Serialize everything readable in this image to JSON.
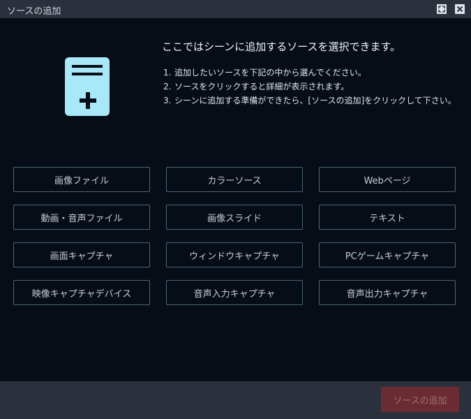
{
  "window": {
    "title": "ソースの追加",
    "maximize_icon": "maximize-icon",
    "close_icon": "close-icon"
  },
  "intro": {
    "heading": "ここではシーンに追加するソースを選択できます。",
    "steps": [
      {
        "num": "1.",
        "text": "追加したいソースを下記の中から選んでください。"
      },
      {
        "num": "2.",
        "text": "ソースをクリックすると詳細が表示されます。"
      },
      {
        "num": "3.",
        "text": "シーンに追加する準備ができたら、[ソースの追加]をクリックして下さい。"
      }
    ],
    "icon": "document-add-icon"
  },
  "sources": [
    "画像ファイル",
    "カラーソース",
    "Webページ",
    "動画・音声ファイル",
    "画像スライド",
    "テキスト",
    "画面キャプチャ",
    "ウィンドウキャプチャ",
    "PCゲームキャプチャ",
    "映像キャプチャデバイス",
    "音声入力キャプチャ",
    "音声出力キャプチャ"
  ],
  "footer": {
    "add_button_label": "ソースの追加"
  },
  "colors": {
    "background": "#070d17",
    "titlebar": "#2b313c",
    "icon_accent": "#a8e8f8",
    "button_border": "#4d6576",
    "add_button_disabled": "#6b2b32"
  }
}
